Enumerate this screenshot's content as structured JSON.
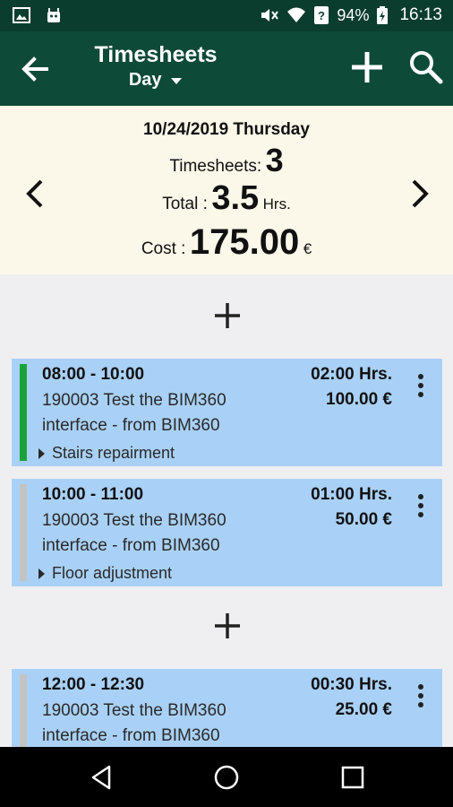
{
  "status_bar": {
    "battery": "94%",
    "time": "16:13"
  },
  "app_bar": {
    "title": "Timesheets",
    "view": "Day"
  },
  "summary": {
    "date": "10/24/2019 Thursday",
    "timesheets_label": "Timesheets:",
    "timesheets_count": "3",
    "total_label": "Total :",
    "total_value": "3.5",
    "total_unit": "Hrs.",
    "cost_label": "Cost :",
    "cost_value": "175.00",
    "cost_unit": "€"
  },
  "entries": [
    {
      "time": "08:00 - 10:00",
      "hours": "02:00 Hrs.",
      "amount": "100.00 €",
      "description": "190003  Test the BIM360 interface - from BIM360",
      "task": "Stairs repairment",
      "bar_color": "#1aa33a"
    },
    {
      "time": "10:00 - 11:00",
      "hours": "01:00 Hrs.",
      "amount": "50.00 €",
      "description": "190003  Test the BIM360 interface - from BIM360",
      "task": "Floor adjustment",
      "bar_color": "#c3c3c3"
    },
    {
      "time": "12:00 - 12:30",
      "hours": "00:30 Hrs.",
      "amount": "25.00 €",
      "description": "190003  Test the BIM360 interface - from BIM360",
      "task": "",
      "bar_color": "#c3c3c3"
    }
  ],
  "colors": {
    "status_bar": "#0b3d2e",
    "app_bar": "#0d4a37",
    "summary_bg": "#fbf8e9",
    "card_bg": "#a9d1f7",
    "page_bg": "#efeff1"
  }
}
